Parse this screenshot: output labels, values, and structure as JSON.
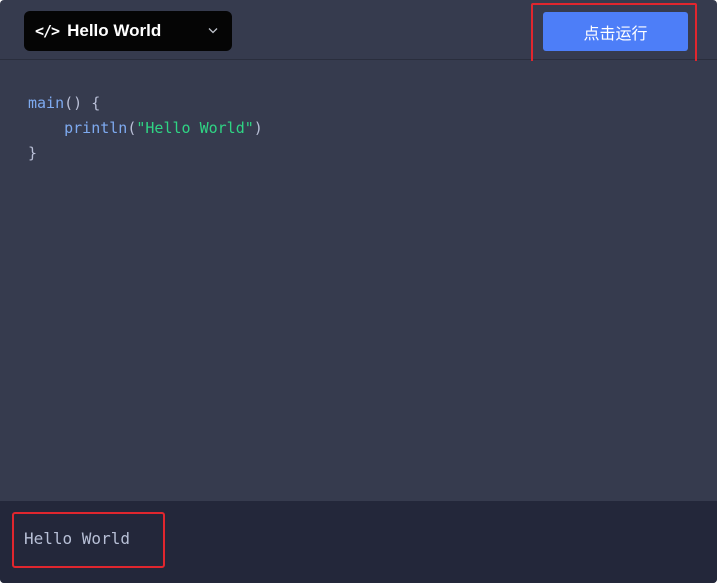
{
  "header": {
    "example_select": {
      "icon": "code-icon",
      "icon_text": "</>",
      "label": "Hello World"
    },
    "run_button": {
      "label": "点击运行"
    }
  },
  "editor": {
    "code": {
      "function_name": "main",
      "signature_rest": "() {",
      "call_name": "println",
      "call_open": "(",
      "string_literal": "\"Hello World\"",
      "call_close": ")",
      "closing_brace": "}"
    }
  },
  "output": {
    "text": "Hello World"
  },
  "colors": {
    "background": "#363b4e",
    "output_background": "#23273a",
    "run_button": "#4d7ef8",
    "string": "#2fd484",
    "function": "#7eaaf0",
    "highlight_border": "#e0262e"
  }
}
